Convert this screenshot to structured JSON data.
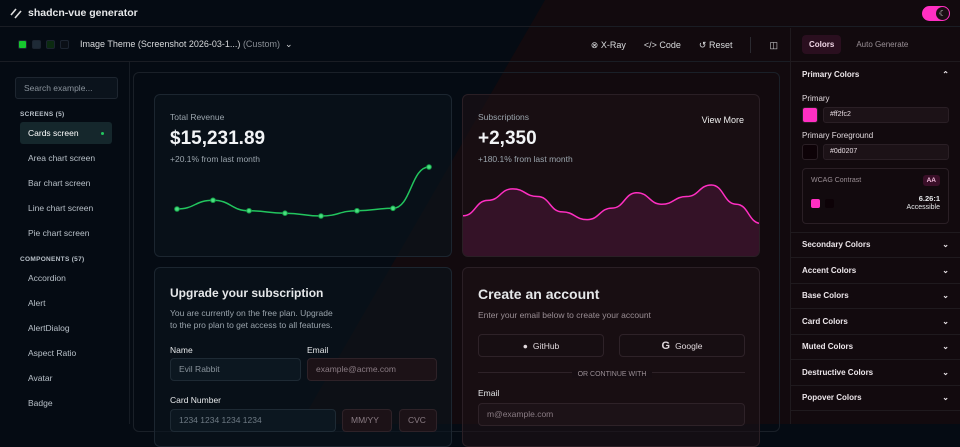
{
  "app": {
    "title": "shadcn-vue generator"
  },
  "toolbar": {
    "swatches": [
      "#16c72e",
      "#1e2a36",
      "#0b2a10",
      "#0a0f16"
    ],
    "theme_name": "Image Theme (Screenshot 2026-03-1...)",
    "theme_tag": "(Custom)",
    "xray": "X-Ray",
    "code": "Code",
    "reset": "Reset"
  },
  "sidebar": {
    "search_placeholder": "Search example...",
    "screens_heading": "SCREENS (5)",
    "screens": [
      "Cards screen",
      "Area chart screen",
      "Bar chart screen",
      "Line chart screen",
      "Pie chart screen"
    ],
    "components_heading": "COMPONENTS (57)",
    "components": [
      "Accordion",
      "Alert",
      "AlertDialog",
      "Aspect Ratio",
      "Avatar",
      "Badge"
    ]
  },
  "revenue": {
    "label": "Total Revenue",
    "value": "$15,231.89",
    "change": "+20.1% from last month",
    "series": [
      8,
      10.5,
      7.5,
      6.8,
      6,
      7.5,
      8.2,
      20
    ],
    "color": "#22c55e"
  },
  "subscriptions": {
    "label": "Subscriptions",
    "value": "+2,350",
    "change": "+180.1% from last month",
    "view_more": "View More",
    "series": [
      5,
      9,
      12,
      10,
      6,
      4,
      7,
      11,
      8,
      10,
      13,
      8,
      3
    ],
    "color": "#ff2fc2"
  },
  "upgrade": {
    "title": "Upgrade your subscription",
    "desc1": "You are currently on the free plan. Upgrade",
    "desc2": "to the pro plan to get access to all features.",
    "name_label": "Name",
    "name_value": "Evil Rabbit",
    "email_label": "Email",
    "email_placeholder": "example@acme.com",
    "card_label": "Card Number",
    "card_placeholder": "1234 1234 1234 1234",
    "exp_placeholder": "MM/YY",
    "cvc_placeholder": "CVC"
  },
  "account": {
    "title": "Create an account",
    "desc": "Enter your email below to create your account",
    "github": "GitHub",
    "google": "Google",
    "divider": "OR CONTINUE WITH",
    "email_label": "Email",
    "email_placeholder": "m@example.com"
  },
  "panel": {
    "tabs": [
      "Colors",
      "Auto Generate"
    ],
    "primary_heading": "Primary Colors",
    "primary_label": "Primary",
    "primary_value": "#ff2fc2",
    "fg_label": "Primary Foreground",
    "fg_value": "#0d0207",
    "wcag_label": "WCAG Contrast",
    "wcag_badge": "AA",
    "ratio": "6.26:1",
    "status": "Accessible",
    "sections": [
      "Secondary Colors",
      "Accent Colors",
      "Base Colors",
      "Card Colors",
      "Muted Colors",
      "Destructive Colors",
      "Popover Colors"
    ]
  }
}
